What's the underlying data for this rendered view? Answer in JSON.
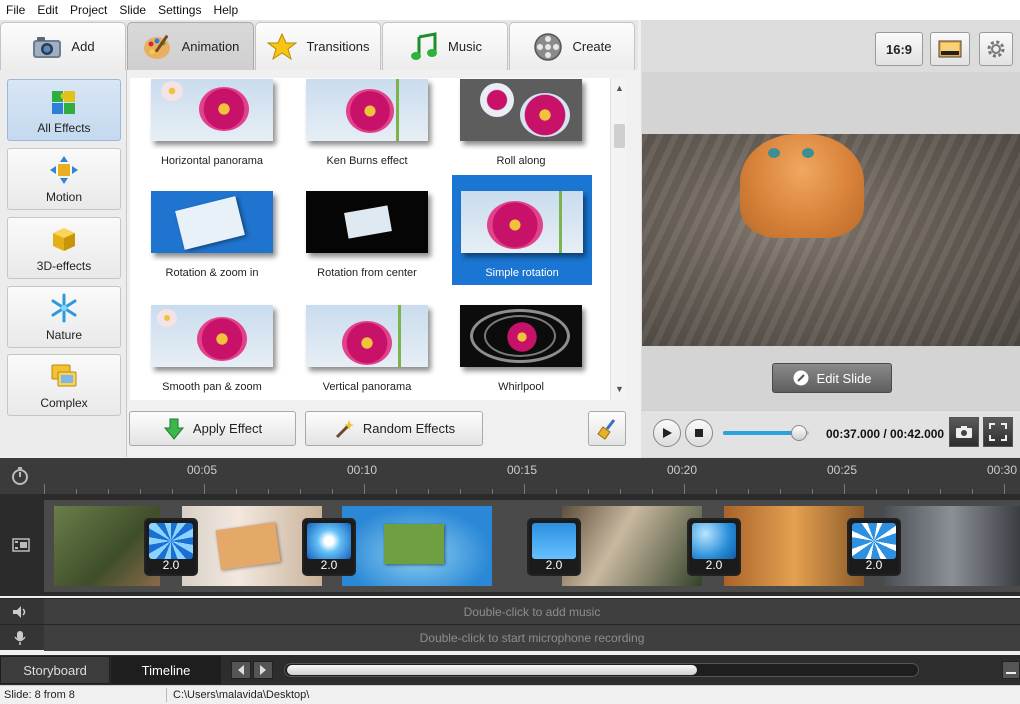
{
  "menu": [
    "File",
    "Edit",
    "Project",
    "Slide",
    "Settings",
    "Help"
  ],
  "tabs": {
    "add": "Add",
    "animation": "Animation",
    "transitions": "Transitions",
    "music": "Music",
    "create": "Create"
  },
  "categories": {
    "all": "All Effects",
    "motion": "Motion",
    "threed": "3D-effects",
    "nature": "Nature",
    "complex": "Complex"
  },
  "effects": [
    "Horizontal panorama",
    "Ken Burns effect",
    "Roll along",
    "Rotation & zoom in",
    "Rotation from center",
    "Simple rotation",
    "Smooth pan & zoom",
    "Vertical panorama",
    "Whirlpool"
  ],
  "buttons": {
    "apply": "Apply Effect",
    "random": "Random Effects"
  },
  "preview": {
    "aspect": "16:9",
    "edit_slide": "Edit Slide",
    "time": "00:37.000 / 00:42.000",
    "progress": 0.88
  },
  "timeline": {
    "ticks": [
      "00:05",
      "00:10",
      "00:15",
      "00:20",
      "00:25",
      "00:30"
    ],
    "durations": [
      "2.0",
      "2.0",
      "2.0",
      "2.0",
      "2.0"
    ],
    "music_hint": "Double-click to add music",
    "mic_hint": "Double-click to start microphone recording"
  },
  "bottom_tabs": {
    "storyboard": "Storyboard",
    "timeline": "Timeline"
  },
  "status": {
    "slide": "Slide: 8 from 8",
    "path": "C:\\Users\\malavida\\Desktop\\"
  },
  "colors": {
    "selection": "#1a76d2",
    "timeline_bg": "#2b2b2b",
    "progress": "#29a3e0"
  }
}
